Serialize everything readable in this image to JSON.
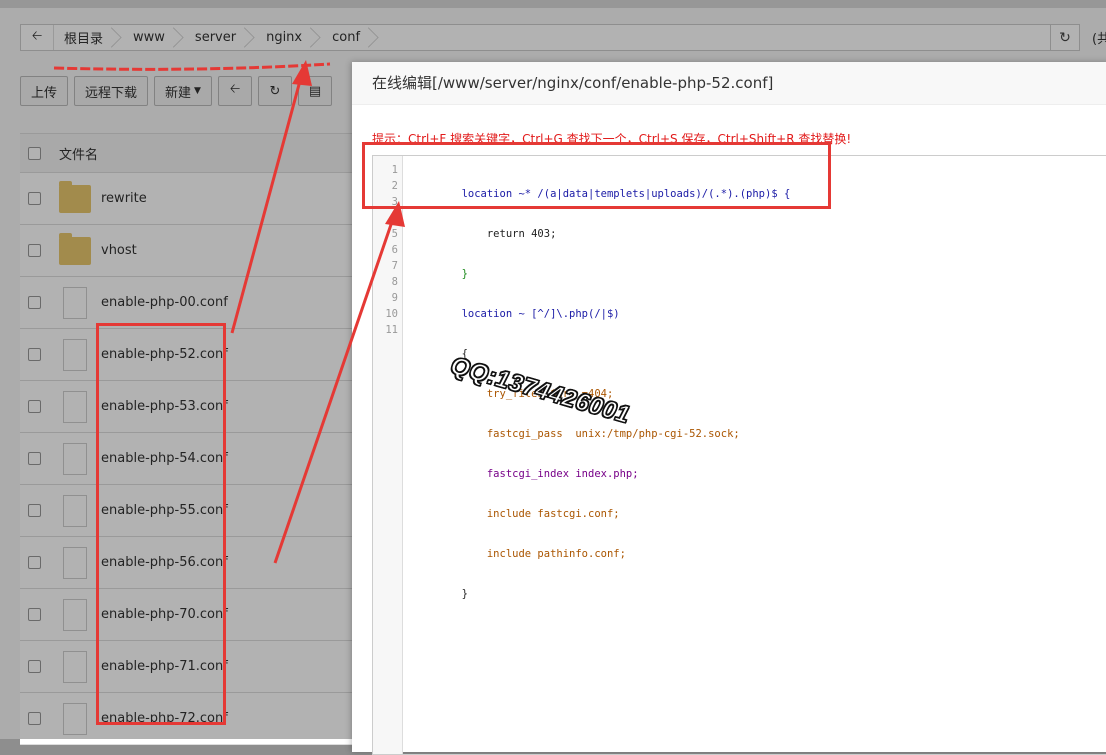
{
  "breadcrumb": {
    "items": [
      "根目录",
      "www",
      "server",
      "nginx",
      "conf"
    ],
    "extra": "(共"
  },
  "toolbar": {
    "upload": "上传",
    "remote_download": "远程下载",
    "new": "新建"
  },
  "filelist": {
    "header": "文件名",
    "rows": [
      {
        "name": "rewrite",
        "type": "folder"
      },
      {
        "name": "vhost",
        "type": "folder"
      },
      {
        "name": "enable-php-00.conf",
        "type": "file"
      },
      {
        "name": "enable-php-52.conf",
        "type": "file"
      },
      {
        "name": "enable-php-53.conf",
        "type": "file"
      },
      {
        "name": "enable-php-54.conf",
        "type": "file"
      },
      {
        "name": "enable-php-55.conf",
        "type": "file"
      },
      {
        "name": "enable-php-56.conf",
        "type": "file"
      },
      {
        "name": "enable-php-70.conf",
        "type": "file"
      },
      {
        "name": "enable-php-71.conf",
        "type": "file"
      },
      {
        "name": "enable-php-72.conf",
        "type": "file"
      }
    ]
  },
  "editor": {
    "title": "在线编辑[/www/server/nginx/conf/enable-php-52.conf]",
    "hint": "提示：Ctrl+F 搜索关键字，Ctrl+G 查找下一个，Ctrl+S 保存，Ctrl+Shift+R 查找替换!",
    "line_numbers": [
      "1",
      "2",
      "3",
      "4",
      "5",
      "6",
      "7",
      "8",
      "9",
      "10",
      "11"
    ],
    "lines": [
      "        location ~* /(a|data|templets|uploads)/(.*).(php)$ {",
      "            return 403;",
      "        }",
      "        location ~ [^/]\\.php(/|$)",
      "        {",
      "            try_files $uri =404;",
      "            fastcgi_pass  unix:/tmp/php-cgi-52.sock;",
      "            fastcgi_index index.php;",
      "            include fastcgi.conf;",
      "            include pathinfo.conf;",
      "        }"
    ]
  },
  "watermark": "QQ:1374426001",
  "colors": {
    "annotation_red": "#e53935",
    "hint_red": "#e21b1b",
    "folder_yellow": "#e8c86d"
  }
}
